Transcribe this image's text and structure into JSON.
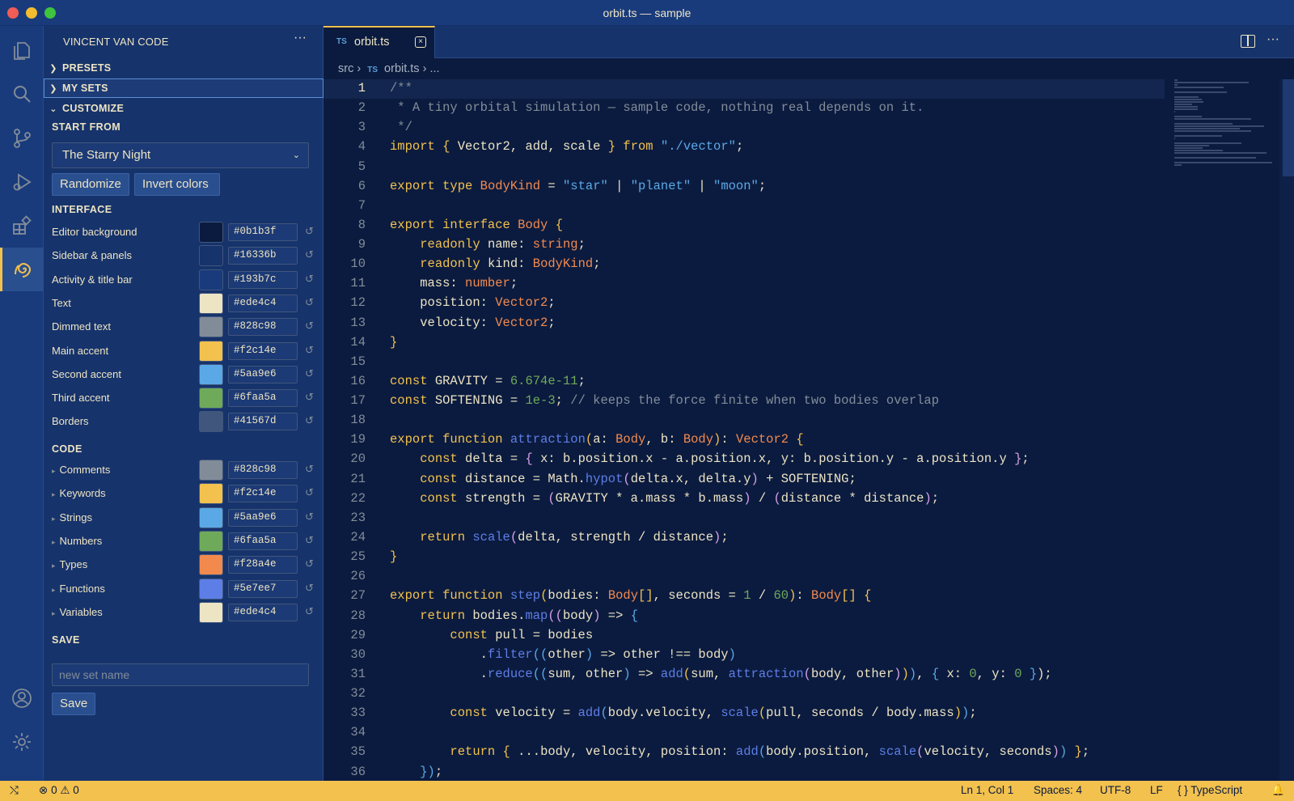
{
  "window": {
    "title": "orbit.ts — sample"
  },
  "activity_bar": {
    "items": [
      "explorer-icon",
      "search-icon",
      "source-control-icon",
      "run-debug-icon",
      "extensions-icon",
      "swirl-icon"
    ],
    "bottom": [
      "account-icon",
      "gear-icon"
    ]
  },
  "sidebar": {
    "title": "VINCENT VAN CODE",
    "sections": {
      "presets": "PRESETS",
      "my_sets": "MY SETS",
      "customize": "CUSTOMIZE"
    },
    "start_from": {
      "label": "START FROM",
      "value": "The Starry Night"
    },
    "buttons": {
      "randomize": "Randomize",
      "invert": "Invert colors"
    },
    "interface": {
      "label": "INTERFACE",
      "rows": [
        {
          "label": "Editor background",
          "hex": "#0b1b3f",
          "color": "#0b1b3f"
        },
        {
          "label": "Sidebar & panels",
          "hex": "#16336b",
          "color": "#16336b"
        },
        {
          "label": "Activity & title bar",
          "hex": "#193b7c",
          "color": "#193b7c"
        },
        {
          "label": "Text",
          "hex": "#ede4c4",
          "color": "#ede4c4"
        },
        {
          "label": "Dimmed text",
          "hex": "#828c98",
          "color": "#828c98"
        },
        {
          "label": "Main accent",
          "hex": "#f2c14e",
          "color": "#f2c14e"
        },
        {
          "label": "Second accent",
          "hex": "#5aa9e6",
          "color": "#5aa9e6"
        },
        {
          "label": "Third accent",
          "hex": "#6faa5a",
          "color": "#6faa5a"
        },
        {
          "label": "Borders",
          "hex": "#41567d",
          "color": "#41567d"
        }
      ]
    },
    "code": {
      "label": "CODE",
      "rows": [
        {
          "label": "Comments",
          "hex": "#828c98",
          "color": "#828c98"
        },
        {
          "label": "Keywords",
          "hex": "#f2c14e",
          "color": "#f2c14e"
        },
        {
          "label": "Strings",
          "hex": "#5aa9e6",
          "color": "#5aa9e6"
        },
        {
          "label": "Numbers",
          "hex": "#6faa5a",
          "color": "#6faa5a"
        },
        {
          "label": "Types",
          "hex": "#f28a4e",
          "color": "#f28a4e"
        },
        {
          "label": "Functions",
          "hex": "#5e7ee7",
          "color": "#5e7ee7"
        },
        {
          "label": "Variables",
          "hex": "#ede4c4",
          "color": "#ede4c4"
        }
      ]
    },
    "save": {
      "label": "SAVE",
      "placeholder": "new set name",
      "button": "Save"
    }
  },
  "editor": {
    "tab": {
      "lang": "TS",
      "name": "orbit.ts"
    },
    "breadcrumb": {
      "folder": "src",
      "lang": "TS",
      "file": "orbit.ts",
      "rest": "..."
    },
    "lines": [
      "<span class=\"c\">/**</span>",
      "<span class=\"c\"> * A tiny orbital simulation — sample code, nothing real depends on it.</span>",
      "<span class=\"c\"> */</span>",
      "<span class=\"k\">import</span> <span class=\"k\">{</span> Vector2, add, scale <span class=\"k\">}</span> <span class=\"k\">from</span> <span class=\"s\">\"./vector\"</span>;",
      "",
      "<span class=\"k\">export</span> <span class=\"k\">type</span> <span class=\"t\">BodyKind</span> = <span class=\"s\">\"star\"</span> | <span class=\"s\">\"planet\"</span> | <span class=\"s\">\"moon\"</span>;",
      "",
      "<span class=\"k\">export</span> <span class=\"k\">interface</span> <span class=\"t\">Body</span> <span class=\"k\">{</span>",
      "    <span class=\"k\">readonly</span> name: <span class=\"t\">string</span>;",
      "    <span class=\"k\">readonly</span> kind: <span class=\"t\">BodyKind</span>;",
      "    mass: <span class=\"t\">number</span>;",
      "    position: <span class=\"t\">Vector2</span>;",
      "    velocity: <span class=\"t\">Vector2</span>;",
      "<span class=\"k\">}</span>",
      "",
      "<span class=\"k\">const</span> GRAVITY = <span class=\"n\">6.674e-11</span>;",
      "<span class=\"k\">const</span> SOFTENING = <span class=\"n\">1e-3</span>; <span class=\"c\">// keeps the force finite when two bodies overlap</span>",
      "",
      "<span class=\"k\">export</span> <span class=\"k\">function</span> <span class=\"f\">attraction</span><span class=\"k\">(</span>a: <span class=\"t\">Body</span>, b: <span class=\"t\">Body</span><span class=\"k\">)</span>: <span class=\"t\">Vector2</span> <span class=\"k\">{</span>",
      "    <span class=\"k\">const</span> delta = <span class=\"p\">{</span> x: b.position.x - a.position.x, y: b.position.y - a.position.y <span class=\"p\">}</span>;",
      "    <span class=\"k\">const</span> distance = Math.<span class=\"f\">hypot</span><span class=\"p\">(</span>delta.x, delta.y<span class=\"p\">)</span> + SOFTENING;",
      "    <span class=\"k\">const</span> strength = <span class=\"p\">(</span>GRAVITY * a.mass * b.mass<span class=\"p\">)</span> / <span class=\"p\">(</span>distance * distance<span class=\"p\">)</span>;",
      "",
      "    <span class=\"k\">return</span> <span class=\"f\">scale</span><span class=\"p\">(</span>delta, strength / distance<span class=\"p\">)</span>;",
      "<span class=\"k\">}</span>",
      "",
      "<span class=\"k\">export</span> <span class=\"k\">function</span> <span class=\"f\">step</span><span class=\"k\">(</span>bodies: <span class=\"t\">Body</span><span class=\"k\">[]</span>, seconds = <span class=\"n\">1</span> / <span class=\"n\">60</span><span class=\"k\">)</span>: <span class=\"t\">Body</span><span class=\"k\">[]</span> <span class=\"k\">{</span>",
      "    <span class=\"k\">return</span> bodies.<span class=\"f\">map</span><span class=\"p\">((</span>body<span class=\"p\">)</span> => <span class=\"s\">{</span>",
      "        <span class=\"k\">const</span> pull = bodies",
      "            .<span class=\"f\">filter</span><span class=\"s\">((</span>other<span class=\"s\">)</span> => other !== body<span class=\"s\">)</span>",
      "            .<span class=\"f\">reduce</span><span class=\"s\">((</span>sum, other<span class=\"s\">)</span> => <span class=\"f\">add</span><span class=\"k\">(</span>sum, <span class=\"f\">attraction</span><span class=\"p\">(</span>body, other<span class=\"p\">)</span><span class=\"k\">)</span><span class=\"s\">)</span>, <span class=\"s\">{</span> x: <span class=\"n\">0</span>, y: <span class=\"n\">0</span> <span class=\"s\">}</span>);",
      "",
      "        <span class=\"k\">const</span> velocity = <span class=\"f\">add</span><span class=\"s\">(</span>body.velocity, <span class=\"f\">scale</span><span class=\"k\">(</span>pull, seconds / body.mass<span class=\"k\">)</span><span class=\"s\">)</span>;",
      "",
      "        <span class=\"k\">return</span> <span class=\"k\">{</span> ...body, velocity, position: <span class=\"f\">add</span><span class=\"s\">(</span>body.position, <span class=\"f\">scale</span><span class=\"p\">(</span>velocity, seconds<span class=\"p\">)</span><span class=\"s\">)</span> <span class=\"k\">}</span>;",
      "    <span class=\"s\">})</span>;"
    ]
  },
  "status": {
    "errors": "0",
    "warnings": "0",
    "position": "Ln 1, Col 1",
    "spaces": "Spaces: 4",
    "encoding": "UTF-8",
    "eol": "LF",
    "language": "TypeScript"
  }
}
